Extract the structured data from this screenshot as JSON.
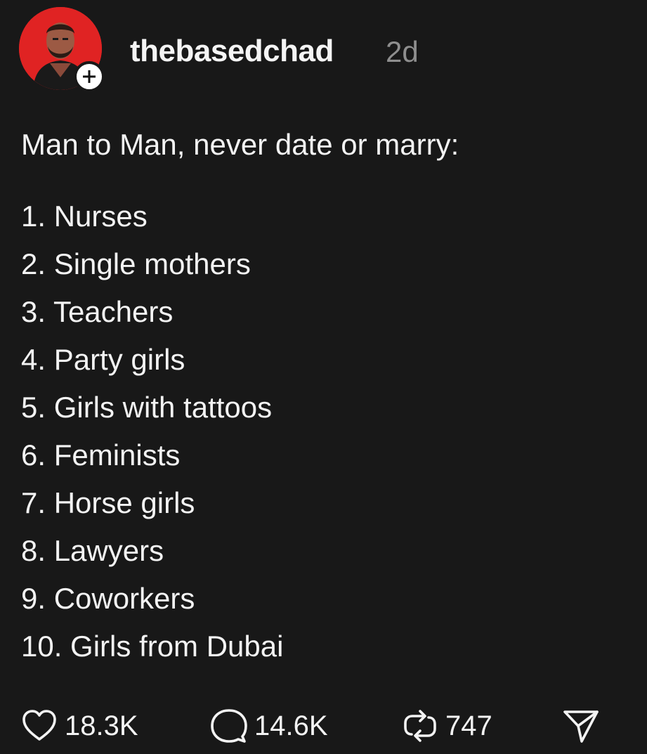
{
  "post": {
    "author": {
      "username": "thebasedchad",
      "avatar_icon": "user-avatar",
      "follow_icon": "plus-icon"
    },
    "timestamp": "2d",
    "intro": "Man to Man, never date or marry:",
    "list": [
      "1. Nurses",
      "2. Single mothers",
      "3. Teachers",
      "4. Party girls",
      "5. Girls with tattoos",
      "6. Feminists",
      "7. Horse girls",
      "8. Lawyers",
      "9. Coworkers",
      "10. Girls from Dubai"
    ],
    "actions": {
      "likes": "18.3K",
      "replies": "14.6K",
      "reposts": "747"
    }
  },
  "colors": {
    "background": "#181818",
    "text": "#f3f3f3",
    "muted": "#8e8e8e",
    "avatar_bg": "#e02323"
  }
}
